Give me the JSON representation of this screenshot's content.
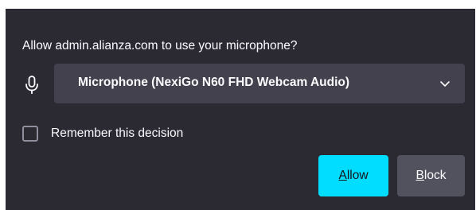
{
  "colors": {
    "dialog_bg": "#2b2a33",
    "select_bg": "#42414d",
    "text": "#fbfbfe",
    "primary_button": "#00ddff",
    "secondary_button": "#52525e"
  },
  "prompt": {
    "text": "Allow admin.alianza.com to use your microphone?"
  },
  "device": {
    "icon": "microphone-icon",
    "selected": "Microphone (NexiGo N60 FHD Webcam Audio)",
    "dropdown_icon": "chevron-down-icon"
  },
  "remember": {
    "label": "Remember this decision",
    "checked": false
  },
  "buttons": {
    "allow": {
      "key": "A",
      "rest": "llow"
    },
    "block": {
      "key": "B",
      "rest": "lock"
    }
  }
}
